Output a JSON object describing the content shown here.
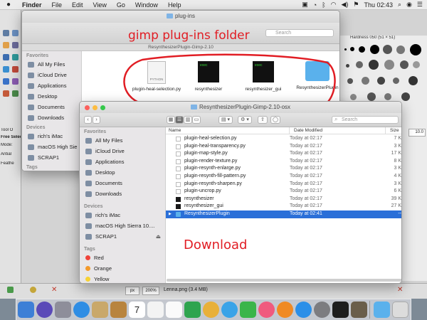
{
  "menubar": {
    "app": "Finder",
    "items": [
      "File",
      "Edit",
      "View",
      "Go",
      "Window",
      "Help"
    ],
    "clock": "Thu 02:43"
  },
  "back_window": {
    "title": "plug-ins",
    "path_title": "ResynthesizerPlugin-Gimp-2.10",
    "search_placeholder": "Search",
    "sidebar": {
      "favorites_header": "Favorites",
      "favorites": [
        "All My Files",
        "iCloud Drive",
        "Applications",
        "Desktop",
        "Documents",
        "Downloads"
      ],
      "devices_header": "Devices",
      "devices": [
        "rich's iMac",
        "macOS High Sie",
        "SCRAP1"
      ],
      "tags_header": "Tags"
    },
    "icons": [
      {
        "label": "plugin-heal-selection.py",
        "kind": "python",
        "badge": "PYTHON"
      },
      {
        "label": "resynthesizer",
        "kind": "exec",
        "badge": "exec"
      },
      {
        "label": "resynthesizer_gui",
        "kind": "exec",
        "badge": "exec"
      },
      {
        "label": "ResynthesizerPlugin",
        "kind": "folder"
      }
    ]
  },
  "front_window": {
    "title": "ResynthesizerPlugin-Gimp-2.10-osx",
    "search_placeholder": "Search",
    "sidebar": {
      "favorites_header": "Favorites",
      "favorites": [
        "All My Files",
        "iCloud Drive",
        "Applications",
        "Desktop",
        "Documents",
        "Downloads"
      ],
      "devices_header": "Devices",
      "devices": [
        "rich's iMac",
        "macOS High Sierra 10....",
        "SCRAP1"
      ],
      "tags_header": "Tags",
      "tags": [
        {
          "label": "Red",
          "color": "#f0433a"
        },
        {
          "label": "Orange",
          "color": "#f39a2b"
        },
        {
          "label": "Yellow",
          "color": "#f7d234"
        }
      ]
    },
    "columns": {
      "name": "Name",
      "date": "Date Modified",
      "size": "Size"
    },
    "files": [
      {
        "name": "plugin-heal-selection.py",
        "date": "Today at 02:17",
        "size": "7 K",
        "kind": "doc"
      },
      {
        "name": "plugin-heal-transparency.py",
        "date": "Today at 02:17",
        "size": "3 K",
        "kind": "doc"
      },
      {
        "name": "plugin-map-style.py",
        "date": "Today at 02:17",
        "size": "17 K",
        "kind": "doc"
      },
      {
        "name": "plugin-render-texture.py",
        "date": "Today at 02:17",
        "size": "8 K",
        "kind": "doc"
      },
      {
        "name": "plugin-resynth-enlarge.py",
        "date": "Today at 02:17",
        "size": "3 K",
        "kind": "doc"
      },
      {
        "name": "plugin-resynth-fill-pattern.py",
        "date": "Today at 02:17",
        "size": "4 K",
        "kind": "doc"
      },
      {
        "name": "plugin-resynth-sharpen.py",
        "date": "Today at 02:17",
        "size": "3 K",
        "kind": "doc"
      },
      {
        "name": "plugin-uncrop.py",
        "date": "Today at 02:17",
        "size": "6 K",
        "kind": "doc"
      },
      {
        "name": "resynthesizer",
        "date": "Today at 02:17",
        "size": "39 K",
        "kind": "exec"
      },
      {
        "name": "resynthesizer_gui",
        "date": "Today at 02:17",
        "size": "27 K",
        "kind": "exec"
      },
      {
        "name": "ResynthesizerPlugin",
        "date": "Today at 02:41",
        "size": "--",
        "kind": "folder",
        "selected": true
      }
    ]
  },
  "annotations": {
    "top": "gimp plug-ins folder",
    "bottom": "Download",
    "color": "#e11d24"
  },
  "gimp": {
    "brushes_title": "Hardness 050 (51 × 51)",
    "brush_size": "10.0",
    "unit": "px",
    "zoom": "200%",
    "status": "Lenna.png (3.4 MB)",
    "left_labels": [
      "Tool O",
      "Free Selec",
      "Mode:",
      "Antial",
      "Feathe"
    ]
  }
}
